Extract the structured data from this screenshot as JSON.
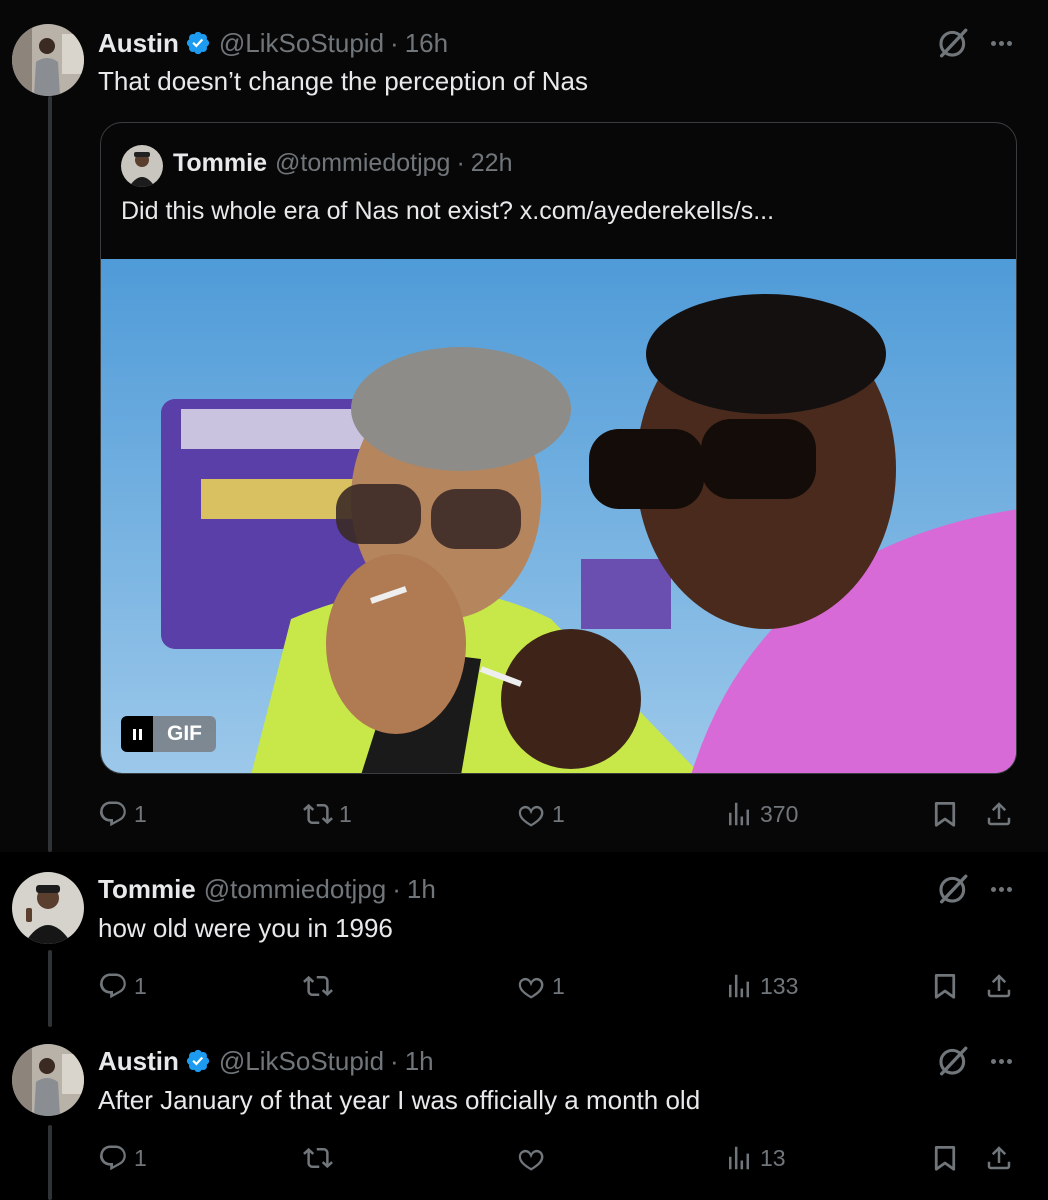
{
  "tweets": [
    {
      "name": "Austin",
      "verified": true,
      "handle": "@LikSoStupid",
      "separator": "·",
      "time": "16h",
      "text": "That doesn’t change the perception of Nas",
      "quote": {
        "name": "Tommie",
        "handle": "@tommiedotjpg",
        "separator": "·",
        "time": "22h",
        "text": "Did this whole era of Nas not exist?  x.com/ayederekells/s...",
        "media_badge": "GIF"
      },
      "replies": "1",
      "reposts": "1",
      "likes": "1",
      "views": "370"
    },
    {
      "name": "Tommie",
      "verified": false,
      "handle": "@tommiedotjpg",
      "separator": "·",
      "time": "1h",
      "text": "how old were you in 1996",
      "replies": "1",
      "reposts": "",
      "likes": "1",
      "views": "133"
    },
    {
      "name": "Austin",
      "verified": true,
      "handle": "@LikSoStupid",
      "separator": "·",
      "time": "1h",
      "text": "After January of that year I was officially a month old",
      "replies": "1",
      "reposts": "",
      "likes": "",
      "views": "13"
    }
  ],
  "icons": {
    "reply": "reply-icon",
    "repost": "repost-icon",
    "like": "like-icon",
    "views": "views-icon",
    "bookmark": "bookmark-icon",
    "share": "share-icon",
    "grok": "grok-icon",
    "more": "more-icon",
    "verified": "verified-badge-icon"
  },
  "colors": {
    "background": "#000000",
    "text": "#e7e9ea",
    "muted": "#71767b",
    "verified": "#1d9bf0",
    "border": "#2f3336"
  }
}
